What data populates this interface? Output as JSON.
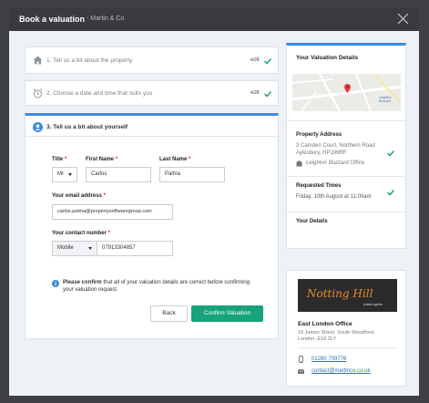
{
  "header": {
    "title": "Book a valuation",
    "subtitle": "- Martin & Co"
  },
  "steps": {
    "step1": {
      "label": "1. Tell us a bit about the property",
      "edit": "edit"
    },
    "step2": {
      "label": "2. Choose a date and time that suits you",
      "edit": "edit"
    },
    "step3": {
      "label": "3. Tell us a bit about yourself"
    }
  },
  "form": {
    "title_label": "Title",
    "title_value": "Mr",
    "first_name_label": "First Name",
    "first_name_value": "Carlos",
    "last_name_label": "Last Name",
    "last_name_value": "Palma",
    "required_mark": "*",
    "email_label": "Your email address",
    "email_value": "carlos.palma@propertysoftwaregroup.com",
    "contact_label": "Your contact number",
    "contact_type": "Mobile",
    "contact_value": "07913304857",
    "notice_bold": "Please confirm",
    "notice_rest": " that all of your valuation details are correct before confirming your valuation request",
    "back_label": "Back",
    "confirm_label": "Confirm Valuation"
  },
  "summary": {
    "title": "Your Valuation Details",
    "map_label": "Leighton Buzzard",
    "property_heading": "Property Address",
    "property_address": "3 Camden Court, Northern Road Aylesbury, HP199RF",
    "office_link": "Leighton Buzzard Office",
    "times_heading": "Requested Times",
    "times_value": "Friday, 10th August at 11:00am",
    "details_heading": "Your Details"
  },
  "office": {
    "logo_text": "Notting Hill",
    "logo_sub": "estate agents",
    "name": "East London Office",
    "address": "19 James Street, South Woodford, London, E18 2LY",
    "phone": "01280 709776",
    "email": "contact@martinco.co.uk"
  },
  "colors": {
    "accent_blue": "#3d8bdb",
    "success_green": "#17a37b",
    "header_bg": "#3a3b3f"
  }
}
